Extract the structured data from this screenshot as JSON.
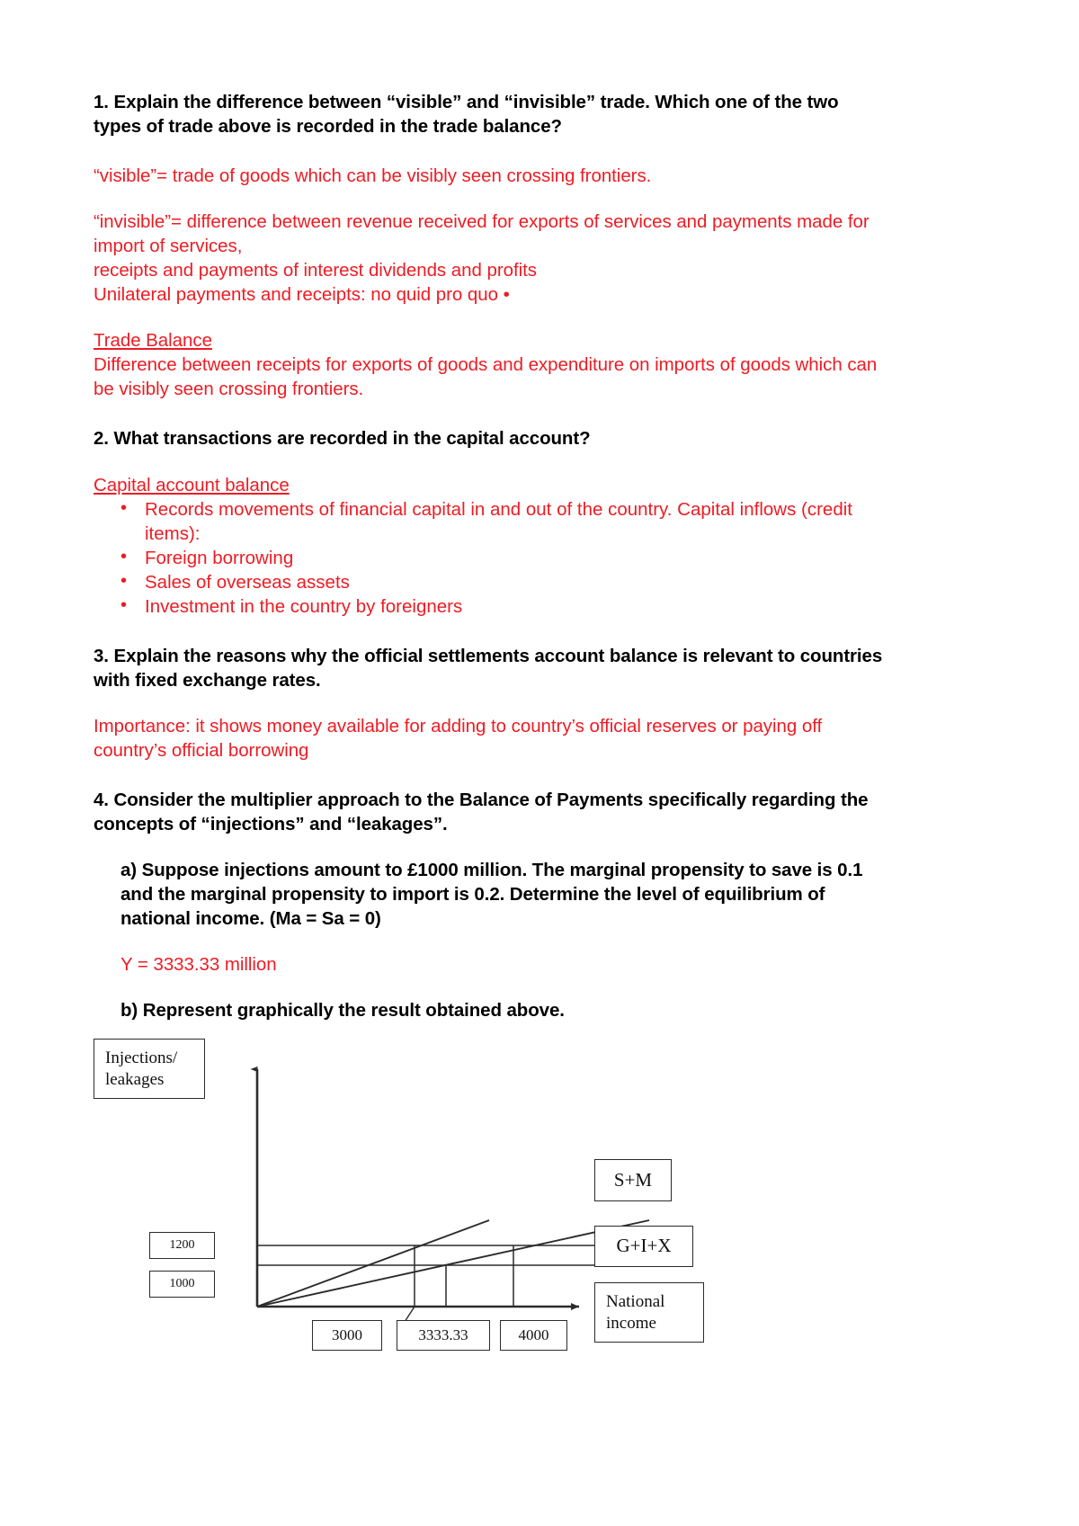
{
  "document": {
    "q1": {
      "question": "1. Explain the difference between “visible” and “invisible” trade. Which one of the two types of trade above is recorded in the trade balance?",
      "answer_visible": "“visible”= trade of goods which can be visibly seen crossing frontiers.",
      "answer_invisible_line1": "“invisible”= difference between revenue received for exports of services and payments made for import of services,",
      "answer_invisible_line2": "receipts and payments of interest dividends and profits",
      "answer_invisible_line3": "Unilateral payments and receipts: no quid pro quo •",
      "trade_balance_heading": "Trade Balance",
      "trade_balance_body": "Difference between receipts for exports of goods and expenditure on imports of goods which can be visibly seen crossing frontiers."
    },
    "q2": {
      "question": "2. What transactions are recorded in the capital account?",
      "capital_heading": "Capital account balance",
      "bullets": [
        "Records movements of financial capital in and out of the country. Capital inflows (credit items):",
        "Foreign borrowing",
        "Sales of overseas assets",
        "Investment in the country by foreigners"
      ]
    },
    "q3": {
      "question": "3. Explain the reasons why the official settlements account balance is relevant to countries with fixed exchange rates.",
      "answer": "Importance: it shows money available for adding to country’s official reserves or paying off country’s official borrowing"
    },
    "q4": {
      "question": "4. Consider the multiplier approach to the Balance of Payments specifically regarding the concepts of “injections” and “leakages”.",
      "part_a": "a) Suppose injections amount to £1000 million. The marginal propensity to save is 0.1 and the marginal propensity to import is 0.2. Determine the level of equilibrium of national income. (Ma = Sa = 0)",
      "answer_a": "Y = 3333.33 million",
      "part_b": "b) Represent graphically the result obtained above."
    }
  },
  "chart_data": {
    "type": "line",
    "title": "",
    "xlabel": "National income",
    "ylabel": "Injections/ leakages",
    "ylabel_line1": "Injections/",
    "ylabel_line2": "leakages",
    "xlabel_line1": "National",
    "xlabel_line2": "income",
    "y_tick_labels": [
      "1200",
      "1000"
    ],
    "y_ticks": [
      1200,
      1000
    ],
    "x_tick_labels": [
      "3000",
      "3333.33",
      "4000"
    ],
    "x_ticks": [
      3000,
      3333.33,
      4000
    ],
    "series": [
      {
        "name": "S+M",
        "slope": 0.3,
        "intercept": 0,
        "note": "steeper leakages line through origin"
      },
      {
        "name": "G+I+X",
        "slope": 0.2,
        "intercept": 0,
        "note": "shallower injections line through origin"
      }
    ],
    "legend_labels": [
      "S+M",
      "G+I+X"
    ],
    "equilibrium": {
      "x": 3333.33,
      "y": 1000
    },
    "grid": false,
    "legend_position": "right"
  },
  "colors": {
    "answer_red": "#ED1C24",
    "question_black": "#000000",
    "diagram_line": "#2b2b2b"
  }
}
